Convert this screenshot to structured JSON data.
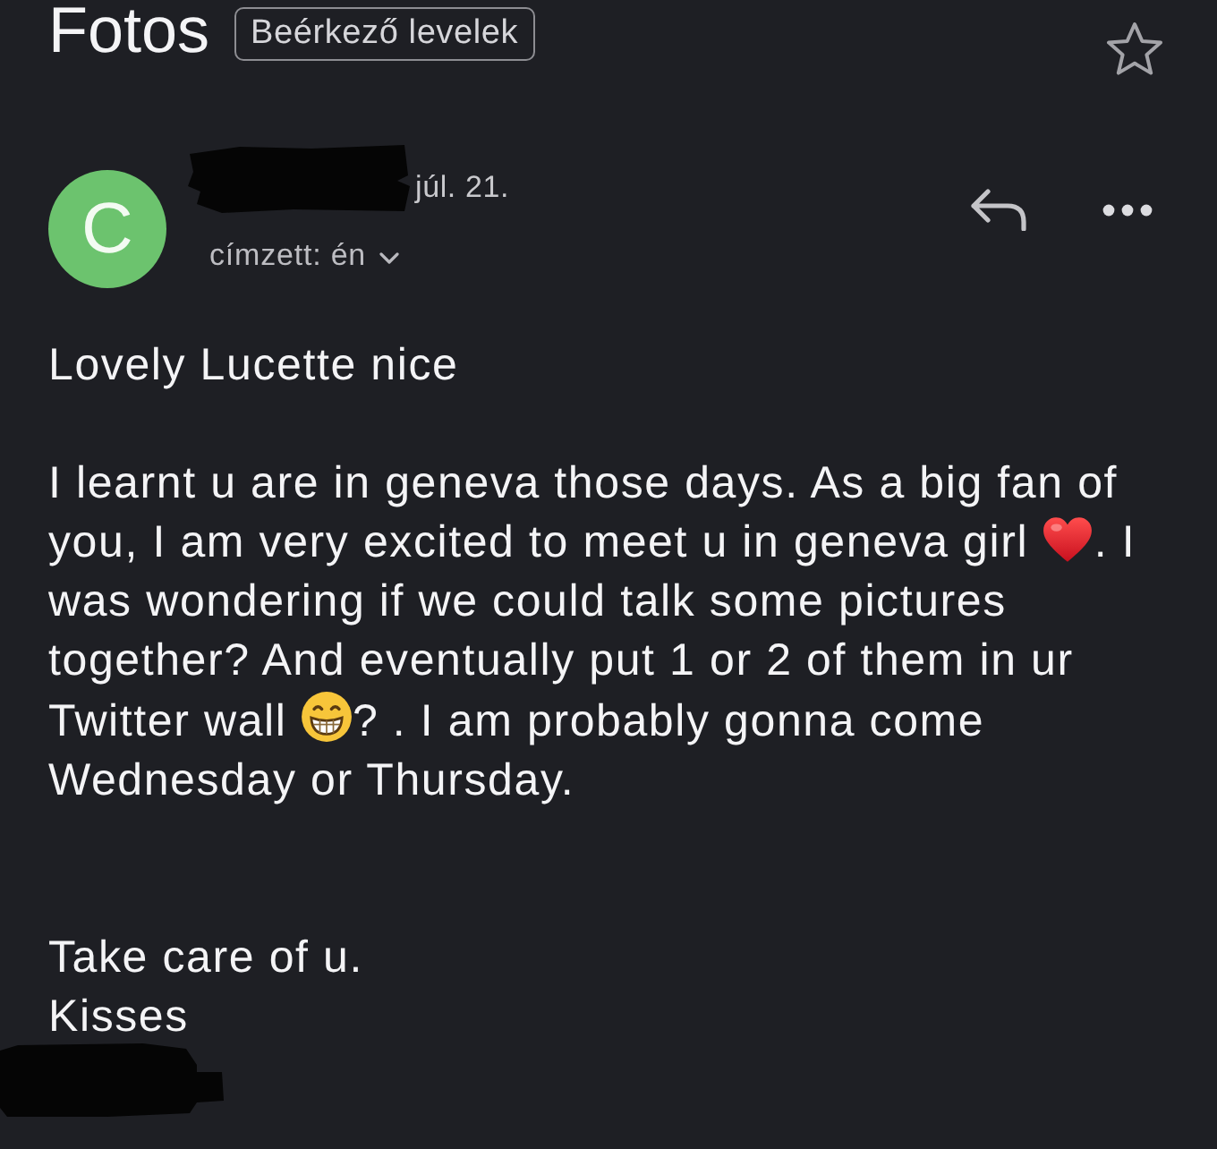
{
  "header": {
    "title": "Fotos",
    "label": "Beérkező levelek",
    "starred": false
  },
  "message": {
    "sender_initial": "C",
    "sender_redacted": true,
    "date": "júl. 21.",
    "recipient": "címzett: én",
    "details_expanded": false
  },
  "body": {
    "greeting": "Lovely Lucette nice",
    "paragraph": [
      {
        "kind": "text",
        "text": "I learnt u are in geneva those days. As a big fan of you, I am very excited to meet u in geneva girl "
      },
      {
        "kind": "heart"
      },
      {
        "kind": "text",
        "text": ". I was wondering if we could talk some pictures together? And eventually put 1 or 2 of them in ur Twitter wall "
      },
      {
        "kind": "grinning"
      },
      {
        "kind": "text",
        "text": "? . I am probably gonna come Wednesday or Thursday."
      }
    ],
    "closing": [
      "Take care of u.",
      "Kisses"
    ],
    "signature_redacted": true
  }
}
